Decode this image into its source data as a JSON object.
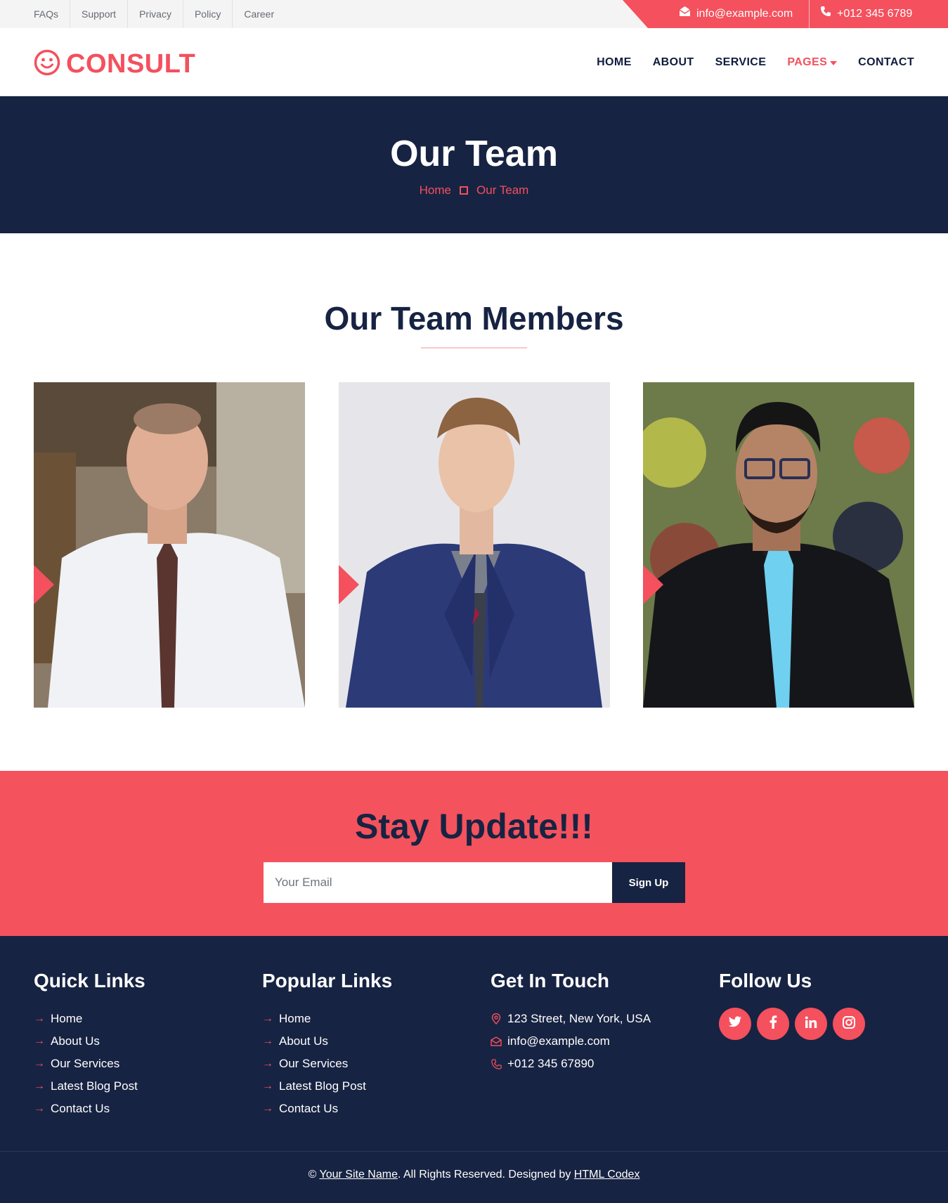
{
  "colors": {
    "primary": "#f4505d",
    "dark": "#172342"
  },
  "topbar": {
    "links": [
      "FAQs",
      "Support",
      "Privacy",
      "Policy",
      "Career"
    ],
    "email": "info@example.com",
    "phone": "+012 345 6789"
  },
  "brand": {
    "name": "CONSULT",
    "icon": "smile-icon"
  },
  "nav": {
    "items": [
      "HOME",
      "ABOUT",
      "SERVICE",
      "PAGES",
      "CONTACT"
    ],
    "active": "PAGES"
  },
  "hero": {
    "title": "Our Team",
    "breadcrumb": [
      "Home",
      "Our Team"
    ]
  },
  "team": {
    "title": "Our Team Members",
    "members": [
      {
        "photo": "man in white shirt with tie"
      },
      {
        "photo": "man in blue blazer"
      },
      {
        "photo": "man with glasses and blue tie"
      }
    ]
  },
  "newsletter": {
    "title": "Stay Update!!!",
    "placeholder": "Your Email",
    "button": "Sign Up"
  },
  "footer": {
    "quick_links": {
      "title": "Quick Links",
      "items": [
        "Home",
        "About Us",
        "Our Services",
        "Latest Blog Post",
        "Contact Us"
      ]
    },
    "popular_links": {
      "title": "Popular Links",
      "items": [
        "Home",
        "About Us",
        "Our Services",
        "Latest Blog Post",
        "Contact Us"
      ]
    },
    "contact": {
      "title": "Get In Touch",
      "address": "123 Street, New York, USA",
      "email": "info@example.com",
      "phone": "+012 345 67890"
    },
    "follow": {
      "title": "Follow Us",
      "icons": [
        "twitter-icon",
        "facebook-icon",
        "linkedin-icon",
        "instagram-icon"
      ]
    },
    "copyright": {
      "prefix": "©",
      "site": "Your Site Name",
      "middle": ". All Rights Reserved. Designed by",
      "designer": "HTML Codex"
    }
  }
}
